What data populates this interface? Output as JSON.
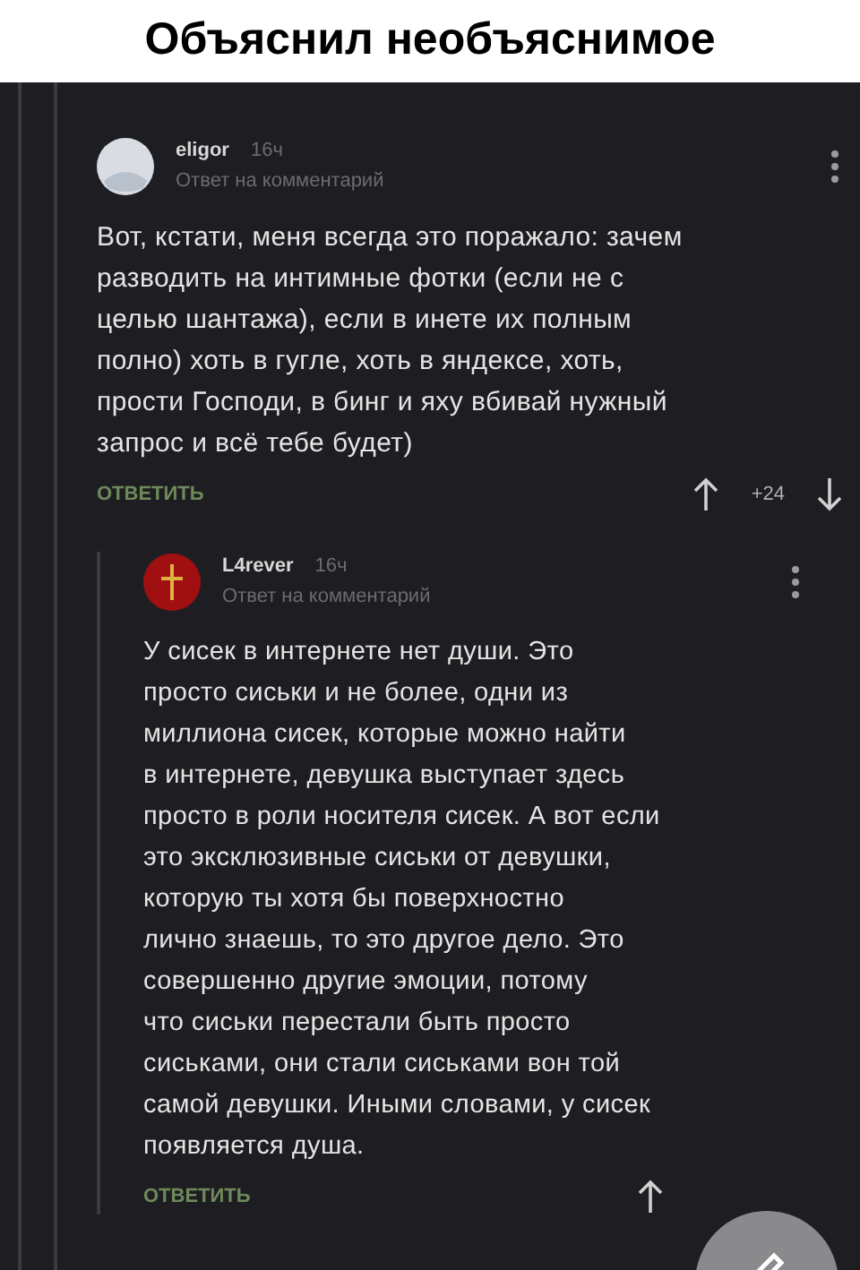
{
  "caption": "Объяснил необъяснимое",
  "comments": [
    {
      "author": "eligor",
      "time": "16ч",
      "subtitle": "Ответ на комментарий",
      "text_lines": [
        "Вот, кстати, меня всегда это поражало: зачем",
        "разводить на интимные фотки (если не с",
        "целью шантажа), если в инете их полным",
        "полно) хоть в гугле, хоть в яндексе, хоть,",
        "прости Господи, в бинг и яху вбивай нужный",
        "запрос и всё тебе будет)"
      ],
      "reply": "ОТВЕТИТЬ",
      "rating": "+24"
    },
    {
      "author": "L4rever",
      "time": "16ч",
      "subtitle": "Ответ на комментарий",
      "text_lines": [
        "У сисек в интернете нет души. Это",
        "просто сиськи и не более, одни из",
        "миллиона сисек, которые можно найти",
        "в интернете, девушка выступает здесь",
        "просто в роли носителя сисек. А вот если",
        "это эксклюзивные сиськи от девушки,",
        "которую ты хотя бы поверхностно",
        "лично знаешь, то это другое дело. Это",
        "совершенно другие эмоции, потому",
        "что сиськи перестали быть просто",
        "сиськами, они стали сиськами вон той",
        "самой девушки. Иными словами, у сисек",
        "появляется душа."
      ],
      "reply": "ОТВЕТИТЬ"
    }
  ]
}
